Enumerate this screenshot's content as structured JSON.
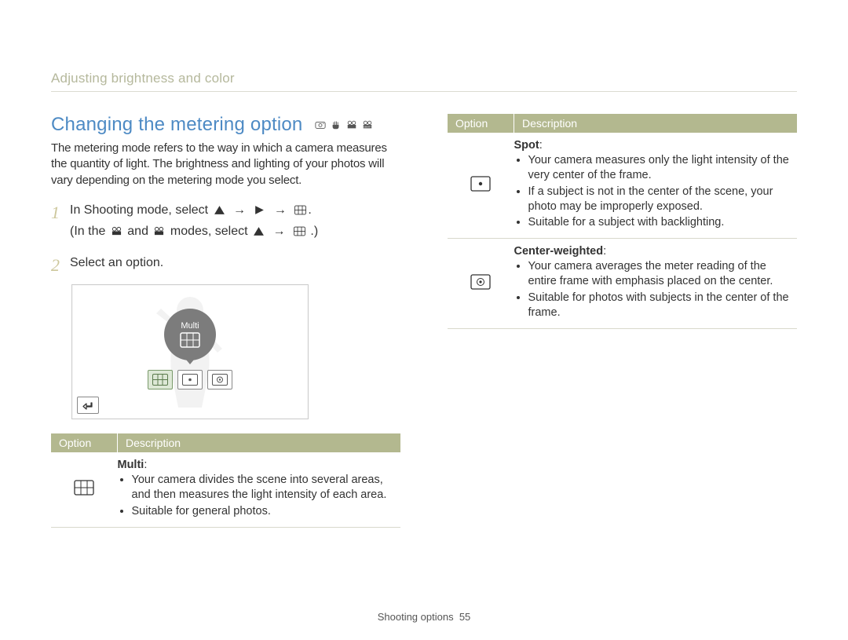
{
  "breadcrumb": "Adjusting brightness and color",
  "heading": "Changing the metering option",
  "intro": "The metering mode refers to the way in which a camera measures the quantity of light. The brightness and lighting of your photos will vary depending on the metering mode you select.",
  "steps": {
    "s1a": "In Shooting mode, select ",
    "s1b": "(In the ",
    "s1c": " and ",
    "s1d": " modes, select ",
    "s1e": ".)",
    "s2": "Select an option."
  },
  "screen": {
    "tooltip": "Multi"
  },
  "table_headers": {
    "option": "Option",
    "description": "Description"
  },
  "options": [
    {
      "icon": "multi",
      "name": "Multi",
      "bullets": [
        "Your camera divides the scene into several areas, and then measures the light intensity of each area.",
        "Suitable for general photos."
      ]
    },
    {
      "icon": "spot",
      "name": "Spot",
      "bullets": [
        "Your camera measures only the light intensity of the very center of the frame.",
        "If a subject is not in the center of the scene, your photo may be improperly exposed.",
        "Suitable for a subject with backlighting."
      ]
    },
    {
      "icon": "center",
      "name": "Center-weighted",
      "bullets": [
        "Your camera averages the meter reading of the entire frame with emphasis placed on the center.",
        "Suitable for photos with subjects in the center of the frame."
      ]
    }
  ],
  "footer": {
    "section": "Shooting options",
    "page": "55"
  }
}
